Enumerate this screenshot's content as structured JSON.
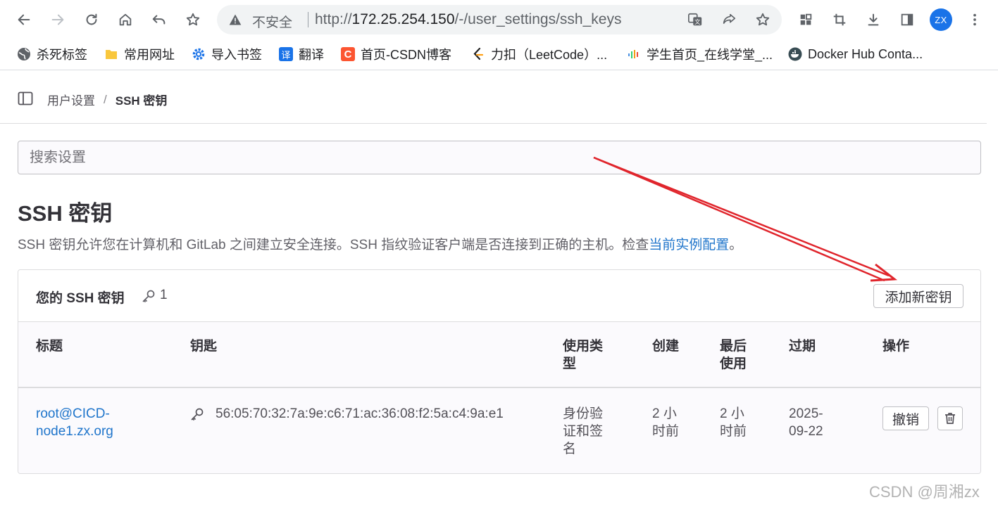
{
  "browser": {
    "security_label": "不安全",
    "url_scheme": "http://",
    "url_host": "172.25.254.150",
    "url_path": "/-/user_settings/ssh_keys",
    "profile_initials": "ZX",
    "bookmarks": [
      {
        "label": "杀死标签",
        "icon": "globe-icon"
      },
      {
        "label": "常用网址",
        "icon": "folder-icon"
      },
      {
        "label": "导入书签",
        "icon": "gear-icon"
      },
      {
        "label": "翻译",
        "icon": "translate-icon",
        "glyph": "译"
      },
      {
        "label": "首页-CSDN博客",
        "icon": "csdn-logo-icon",
        "glyph": "C"
      },
      {
        "label": "力扣（LeetCode）...",
        "icon": "leetcode-logo-icon"
      },
      {
        "label": "学生首页_在线学堂_...",
        "icon": "bars-logo-icon"
      },
      {
        "label": "Docker Hub Conta...",
        "icon": "docker-logo-icon"
      }
    ]
  },
  "breadcrumb": {
    "parent": "用户设置",
    "separator": "/",
    "current": "SSH 密钥"
  },
  "search": {
    "placeholder": "搜索设置"
  },
  "page": {
    "title": "SSH 密钥",
    "description": "SSH 密钥允许您在计算机和 GitLab 之间建立安全连接。SSH 指纹验证客户端是否连接到正确的主机。检查",
    "description_link": "当前实例配置",
    "description_end": "。"
  },
  "keys_card": {
    "title": "您的 SSH 密钥",
    "count": "1",
    "add_button": "添加新密钥",
    "columns": {
      "title": "标题",
      "key": "钥匙",
      "usage_line1": "使用类",
      "usage_line2": "型",
      "created": "创建",
      "last_used_line1": "最后",
      "last_used_line2": "使用",
      "expires": "过期",
      "actions": "操作"
    },
    "rows": [
      {
        "title_line1": "root@CICD-",
        "title_line2": "node1.zx.org",
        "fingerprint": "56:05:70:32:7a:9e:c6:71:ac:36:08:f2:5a:c4:9a:e1",
        "usage_line1": "身份验",
        "usage_line2": "证和签",
        "usage_line3": "名",
        "created_line1": "2 小",
        "created_line2": "时前",
        "last_used_line1": "2 小",
        "last_used_line2": "时前",
        "expires_line1": "2025-",
        "expires_line2": "09-22",
        "revoke_button": "撤销"
      }
    ]
  },
  "watermark": "CSDN @周湘zx",
  "colors": {
    "link": "#1f75cb",
    "annotation_arrow": "#e0252c",
    "avatar": "#1a73e8"
  }
}
